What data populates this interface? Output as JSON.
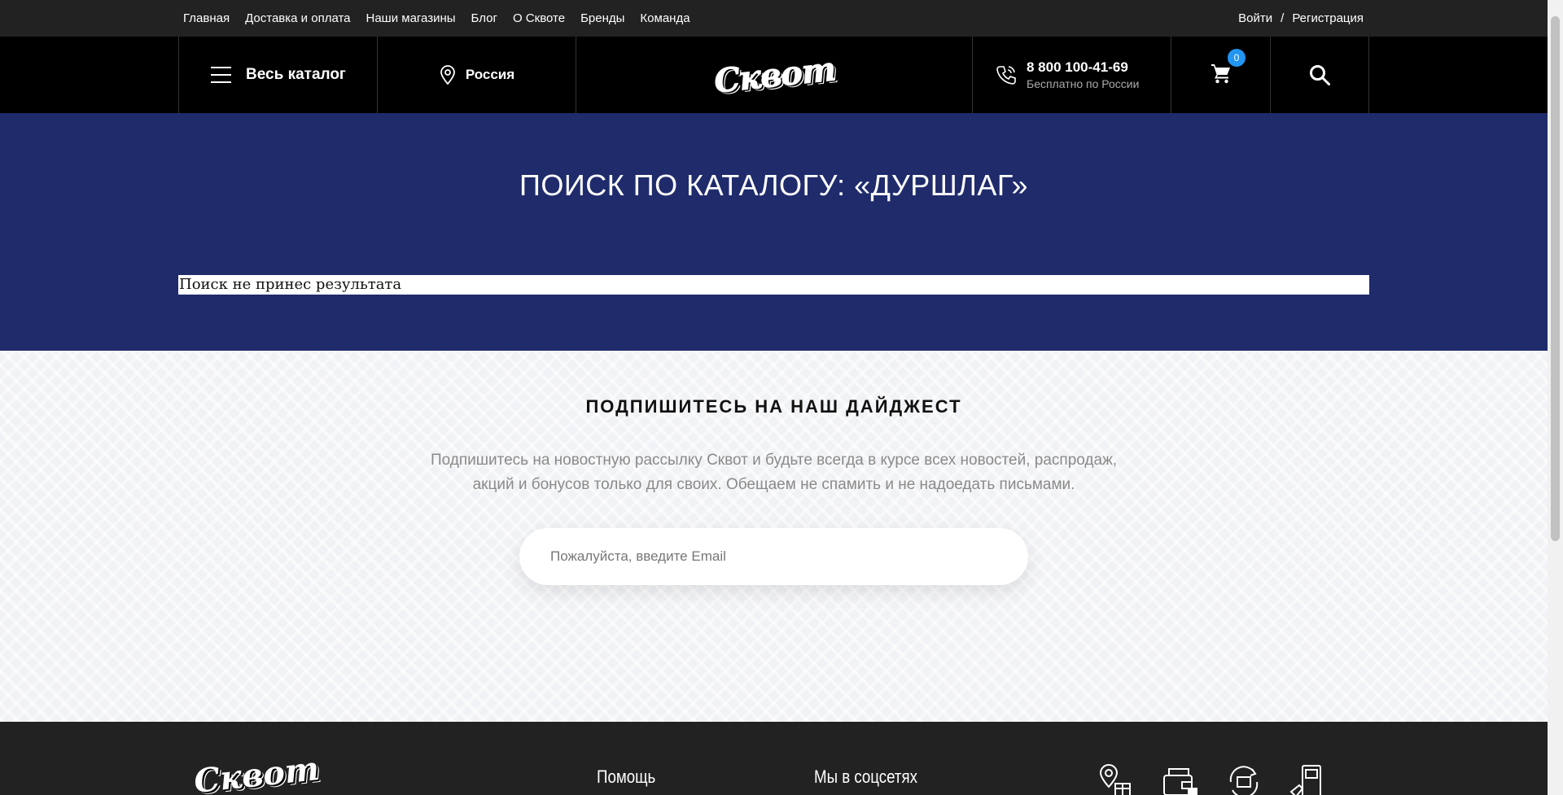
{
  "top_nav": {
    "links": [
      "Главная",
      "Доставка и оплата",
      "Наши магазины",
      "Блог",
      "О Сквоте",
      "Бренды",
      "Команда"
    ],
    "login": "Войти",
    "separator": "/",
    "register": "Регистрация"
  },
  "header": {
    "catalog_label": "Весь каталог",
    "region": "Россия",
    "logo_text": "Сквот",
    "phone": "8 800 100-41-69",
    "phone_note": "Бесплатно по России",
    "cart_count": "0",
    "icons": [
      "menu-icon",
      "location-pin-icon",
      "phone-icon",
      "cart-icon",
      "search-icon"
    ]
  },
  "search": {
    "title": "ПОИСК ПО КАТАЛОГУ: «ДУРШЛАГ»",
    "no_result": "Поиск не принес результата"
  },
  "digest": {
    "title": "ПОДПИШИТЕСЬ НА НАШ ДАЙДЖЕСТ",
    "text_line1": "Подпишитесь на новостную рассылку Сквот и будьте всегда в курсе всех новостей, распродаж,",
    "text_line2": "акций и бонусов только для своих. Обещаем не спамить и не надоедать письмами.",
    "email_placeholder": "Пожалуйста, введите Email"
  },
  "footer": {
    "logo_text": "Сквот",
    "help_heading": "Помощь",
    "social_heading": "Мы в соцсетях",
    "icons": [
      "store-location-icon",
      "payment-icon",
      "return-icon",
      "delivery-icon"
    ]
  },
  "colors": {
    "topbar": "#222222",
    "header": "#000000",
    "hero": "#1f2b6b",
    "badge": "#2196f3",
    "digest_bg": "#f1f2f5"
  }
}
